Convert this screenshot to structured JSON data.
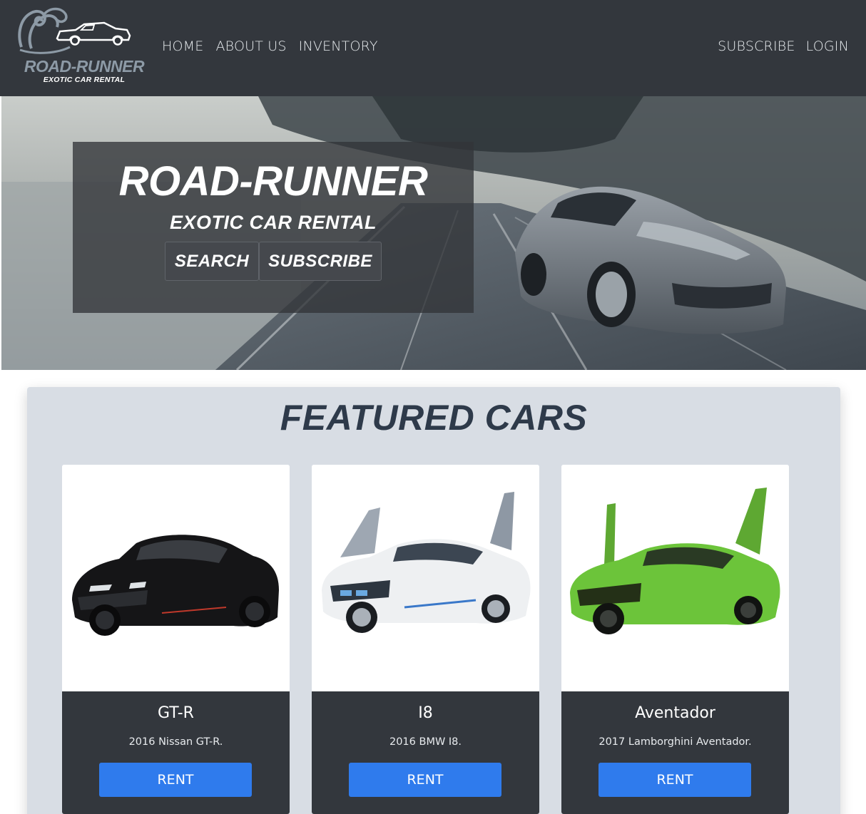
{
  "brand": {
    "logo_name": "ROAD-RUNNER",
    "logo_tagline": "EXOTIC CAR RENTAL"
  },
  "nav": {
    "left": [
      "HOME",
      "ABOUT US",
      "INVENTORY"
    ],
    "right": [
      "SUBSCRIBE",
      "LOGIN"
    ]
  },
  "hero": {
    "title": "ROAD-RUNNER",
    "subtitle": "EXOTIC CAR RENTAL",
    "search_label": "SEARCH",
    "subscribe_label": "SUBSCRIBE"
  },
  "featured": {
    "heading": "FEATURED CARS",
    "cards": [
      {
        "title": "GT-R",
        "text": "2016 Nissan GT-R.",
        "button": "RENT",
        "car_color": "#151517"
      },
      {
        "title": "I8",
        "text": "2016 BMW I8.",
        "button": "RENT",
        "car_color": "#eef0f2"
      },
      {
        "title": "Aventador",
        "text": "2017 Lamborghini Aventador.",
        "button": "RENT",
        "car_color": "#6cc43a"
      }
    ]
  },
  "colors": {
    "navbar": "#33373d",
    "accent_button": "#2f7bed",
    "featured_bg": "#d8dde4",
    "heading": "#2e3a4a"
  }
}
